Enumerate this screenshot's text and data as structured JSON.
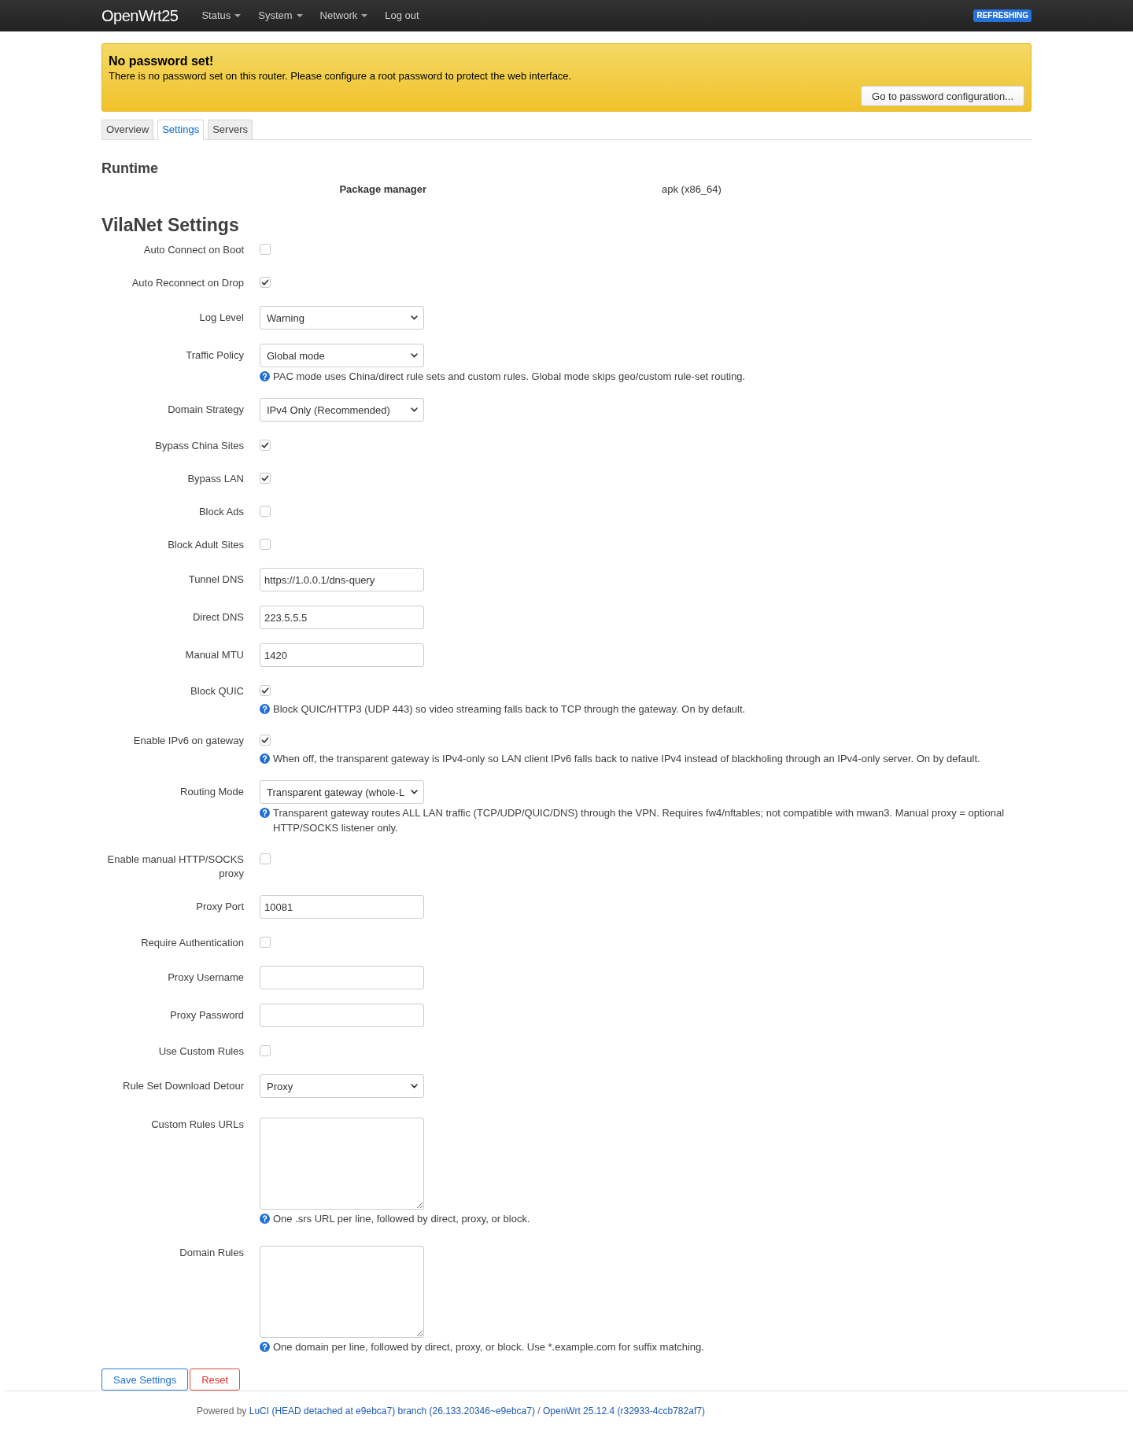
{
  "header": {
    "brand": "OpenWrt25",
    "menu": [
      {
        "label": "Status",
        "dropdown": true
      },
      {
        "label": "System",
        "dropdown": true
      },
      {
        "label": "Network",
        "dropdown": true
      },
      {
        "label": "Log out",
        "dropdown": false
      }
    ],
    "badge": "REFRESHING"
  },
  "alert": {
    "title": "No password set!",
    "message": "There is no password set on this router. Please configure a root password to protect the web interface.",
    "button": "Go to password configuration..."
  },
  "tabs": [
    {
      "label": "Overview",
      "selected": false
    },
    {
      "label": "Settings",
      "selected": true
    },
    {
      "label": "Servers",
      "selected": false
    }
  ],
  "runtime": {
    "title": "Runtime",
    "rows": [
      {
        "label": "Package manager",
        "value": "apk (x86_64)"
      }
    ]
  },
  "settings": {
    "title": "VilaNet Settings",
    "fields": [
      {
        "kind": "checkbox",
        "label": "Auto Connect on Boot",
        "checked": false
      },
      {
        "kind": "checkbox",
        "label": "Auto Reconnect on Drop",
        "checked": true
      },
      {
        "kind": "select",
        "label": "Log Level",
        "value": "Warning"
      },
      {
        "kind": "select",
        "label": "Traffic Policy",
        "value": "Global mode",
        "help": "PAC mode uses China/direct rule sets and custom rules. Global mode skips geo/custom rule-set routing."
      },
      {
        "kind": "select",
        "label": "Domain Strategy",
        "value": "IPv4 Only (Recommended)"
      },
      {
        "kind": "checkbox",
        "label": "Bypass China Sites",
        "checked": true
      },
      {
        "kind": "checkbox",
        "label": "Bypass LAN",
        "checked": true
      },
      {
        "kind": "checkbox",
        "label": "Block Ads",
        "checked": false
      },
      {
        "kind": "checkbox",
        "label": "Block Adult Sites",
        "checked": false
      },
      {
        "kind": "text",
        "label": "Tunnel DNS",
        "value": "https://1.0.0.1/dns-query"
      },
      {
        "kind": "text",
        "label": "Direct DNS",
        "value": "223.5.5.5"
      },
      {
        "kind": "text",
        "label": "Manual MTU",
        "value": "1420"
      },
      {
        "kind": "checkbox",
        "label": "Block QUIC",
        "checked": true,
        "help": "Block QUIC/HTTP3 (UDP 443) so video streaming falls back to TCP through the gateway. On by default."
      },
      {
        "kind": "checkbox",
        "label": "Enable IPv6 on gateway",
        "checked": true,
        "help": "When off, the transparent gateway is IPv4-only so LAN client IPv6 falls back to native IPv4 instead of blackholing through an IPv4-only server. On by default."
      },
      {
        "kind": "select",
        "label": "Routing Mode",
        "value": "Transparent gateway (whole-L",
        "help": "Transparent gateway routes ALL LAN traffic (TCP/UDP/QUIC/DNS) through the VPN. Requires fw4/nftables; not compatible with mwan3. Manual proxy = optional HTTP/SOCKS listener only."
      },
      {
        "kind": "checkbox",
        "label": "Enable manual HTTP/SOCKS proxy",
        "checked": false
      },
      {
        "kind": "text",
        "label": "Proxy Port",
        "value": "10081"
      },
      {
        "kind": "checkbox",
        "label": "Require Authentication",
        "checked": false
      },
      {
        "kind": "text",
        "label": "Proxy Username"
      },
      {
        "kind": "text",
        "label": "Proxy Password"
      },
      {
        "kind": "checkbox",
        "label": "Use Custom Rules",
        "checked": false
      },
      {
        "kind": "select",
        "label": "Rule Set Download Detour",
        "value": "Proxy"
      },
      {
        "kind": "textarea",
        "label": "Custom Rules URLs",
        "help": "One .srs URL per line, followed by direct, proxy, or block."
      },
      {
        "kind": "textarea",
        "label": "Domain Rules",
        "help": "One domain per line, followed by direct, proxy, or block. Use *.example.com for suffix matching."
      }
    ]
  },
  "buttons": [
    {
      "kind": "primary",
      "label": "Save Settings"
    },
    {
      "kind": "danger",
      "label": "Reset"
    }
  ],
  "footer": {
    "prefix": "Powered by",
    "links": [
      "LuCI (HEAD detached at e9ebca7) branch (26.133.20346~e9ebca7)",
      "OpenWrt 25.12.4 (r32933-4ccb782af7)"
    ],
    "separator": "/"
  }
}
